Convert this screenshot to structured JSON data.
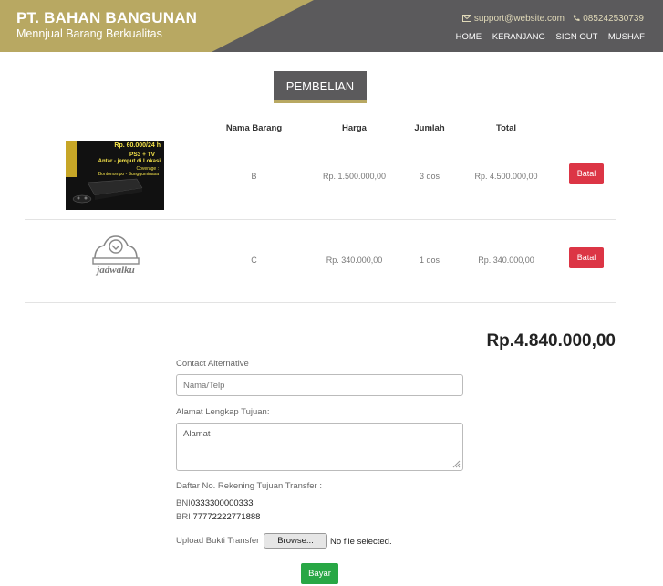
{
  "header": {
    "brand_title": "PT. BAHAN BANGUNAN",
    "brand_subtitle": "Mennjual Barang Berkualitas",
    "email": "support@website.com",
    "phone": "085242530739",
    "nav": [
      "HOME",
      "KERANJANG",
      "SIGN OUT",
      "MUSHAF"
    ],
    "colors": {
      "header_bg": "#5b5a5c",
      "gold": "#b8a862"
    }
  },
  "section_title": "PEMBELIAN",
  "table": {
    "headers": {
      "name": "Nama Barang",
      "price": "Harga",
      "qty": "Jumlah",
      "total": "Total"
    },
    "rows": [
      {
        "name": "B",
        "price": "Rp. 1.500.000,00",
        "qty": "3 dos",
        "total": "Rp. 4.500.000,00",
        "action": "Batal"
      },
      {
        "name": "C",
        "price": "Rp. 340.000,00",
        "qty": "1 dos",
        "total": "Rp. 340.000,00",
        "action": "Batal"
      }
    ],
    "product1_image_text": {
      "line1": "Rp. 60.000/24 h",
      "line2": "PS3 + TV",
      "line3": "Antar - jemput di Lokasi",
      "line4": "Coverage :",
      "line5": "Bontonompo - Sungguminasa"
    },
    "product2_logo_text": "jadwalku"
  },
  "grand_total": "Rp.4.840.000,00",
  "form": {
    "contact_label": "Contact Alternative",
    "contact_placeholder": "Nama/Telp",
    "address_label": "Alamat Lengkap Tujuan:",
    "address_placeholder": "Alamat",
    "bank_label": "Daftar No. Rekening Tujuan Transfer :",
    "banks": [
      {
        "code": "BNI",
        "number": "0333300000333"
      },
      {
        "code": "BRI",
        "number": "77772222771888"
      }
    ],
    "upload_label": "Upload Bukti Transfer",
    "browse_label": "Browse...",
    "no_file_text": "No file selected.",
    "submit_label": "Bayar"
  }
}
